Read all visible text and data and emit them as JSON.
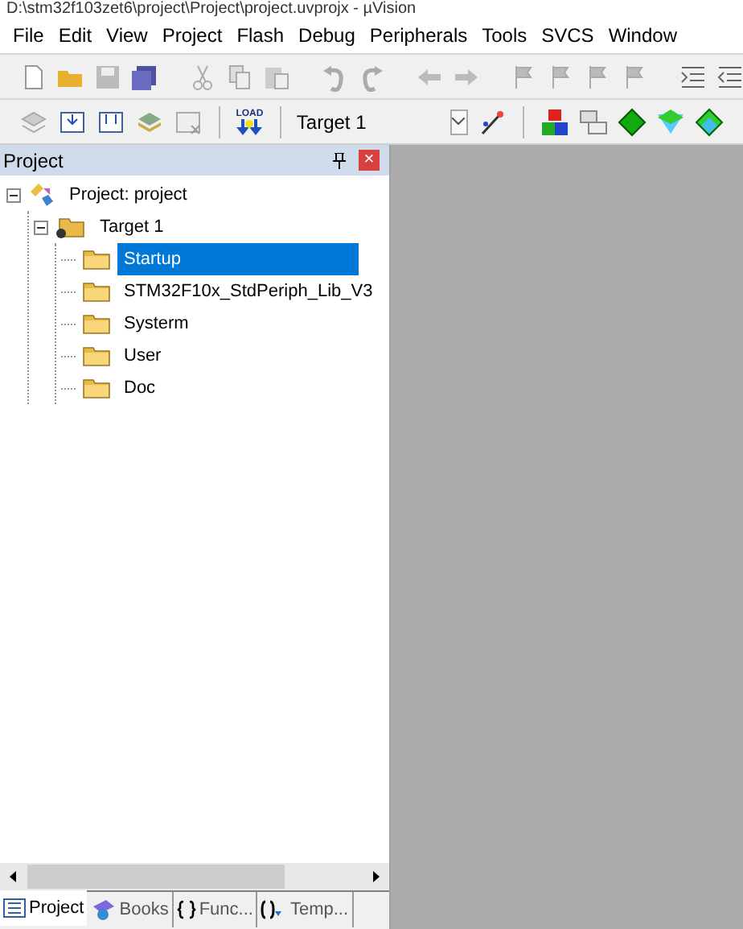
{
  "window": {
    "title": "D:\\stm32f103zet6\\project\\Project\\project.uvprojx - µVision"
  },
  "menu": [
    "File",
    "Edit",
    "View",
    "Project",
    "Flash",
    "Debug",
    "Peripherals",
    "Tools",
    "SVCS",
    "Window"
  ],
  "build_toolbar": {
    "load_label": "LOAD",
    "target": "Target 1"
  },
  "project_panel": {
    "title": "Project",
    "close": "×",
    "tree": [
      {
        "label": "Project: project",
        "kind": "project",
        "expanded": true,
        "selected": false,
        "children": [
          {
            "label": "Target 1",
            "kind": "target",
            "expanded": true,
            "selected": false,
            "children": [
              {
                "label": "Startup",
                "kind": "group",
                "selected": true
              },
              {
                "label": "STM32F10x_StdPeriph_Lib_V3",
                "kind": "group",
                "selected": false
              },
              {
                "label": "Systerm",
                "kind": "group",
                "selected": false
              },
              {
                "label": "User",
                "kind": "group",
                "selected": false
              },
              {
                "label": "Doc",
                "kind": "group",
                "selected": false
              }
            ]
          }
        ]
      }
    ],
    "tabs": [
      {
        "label": "Project",
        "kind": "project",
        "selected": true
      },
      {
        "label": "Books",
        "kind": "books",
        "selected": false
      },
      {
        "label": "Func...",
        "kind": "functions",
        "selected": false
      },
      {
        "label": "Temp...",
        "kind": "templates",
        "selected": false
      }
    ]
  }
}
